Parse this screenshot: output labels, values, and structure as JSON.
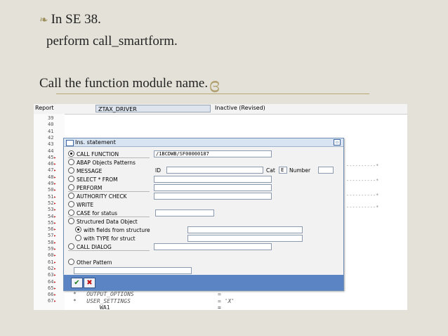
{
  "slide": {
    "line1": "In SE 38.",
    "line2": "perform call_smartform.",
    "line3": "Call the function module name."
  },
  "editor": {
    "report_label": "Report",
    "report_name": "ZTAX_DRIVER",
    "status": "Inactive (Revised)",
    "line_numbers": [
      "39",
      "40",
      "41",
      "42",
      "43",
      "44",
      "45",
      "46",
      "47",
      "48",
      "49",
      "50",
      "51",
      "52",
      "53",
      "54",
      "55",
      "56",
      "57",
      "58",
      "59",
      "60",
      "61",
      "62",
      "63",
      "64",
      "65",
      "66",
      "67"
    ],
    "code_lines": [
      {
        "text": "OUTPUT_OPTIONS",
        "value": "="
      },
      {
        "text": "USER_SETTINGS",
        "value": "= 'X'"
      },
      {
        "text": "WA1",
        "value": "="
      }
    ],
    "dash_text": "----------*"
  },
  "dialog": {
    "title": "Ins. statement",
    "call_function_value": "/1BCDWB/SF00000187",
    "options": [
      "CALL FUNCTION",
      "ABAP Objects Patterns",
      "MESSAGE",
      "SELECT * FROM",
      "PERFORM",
      "AUTHORITY CHECK",
      "WRITE",
      "CASE for status",
      "Structured Data Object",
      "with fields from structure",
      "with TYPE for struct",
      "CALL DIALOG",
      "Other Pattern"
    ],
    "id_label": "ID",
    "cat_label": "Cat",
    "cat_value": "E",
    "number_label": "Number",
    "ok_glyph": "✔",
    "cancel_glyph": "✖"
  }
}
